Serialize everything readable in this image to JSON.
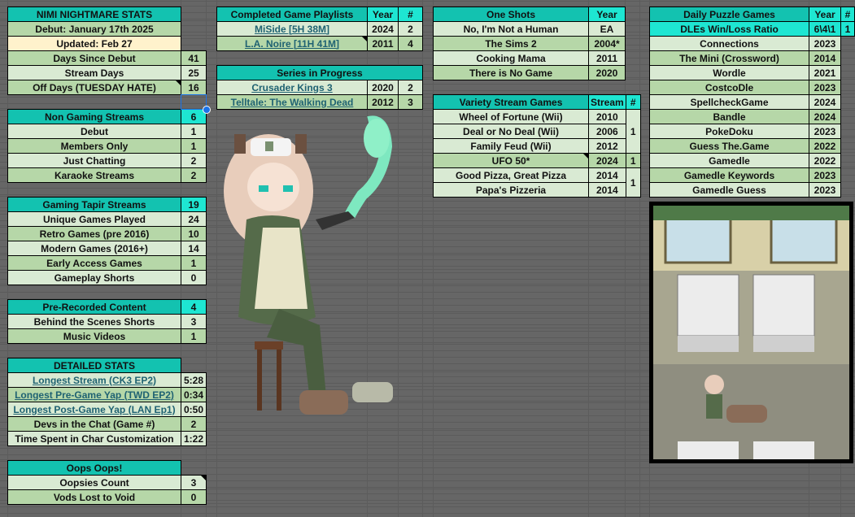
{
  "tables": {
    "nimi_stats": {
      "rows": [
        {
          "tone": "header",
          "cells": [
            "NIMI NIGHTMARE STATS"
          ]
        },
        {
          "tone": "mid",
          "cells": [
            "Debut: January 17th 2025"
          ]
        },
        {
          "tone": "cream",
          "cells": [
            "Updated: Feb 27"
          ]
        },
        {
          "tone": "mid",
          "cells": [
            "Days Since Debut",
            "41"
          ]
        },
        {
          "tone": "light",
          "cells": [
            "Stream Days",
            "25"
          ]
        },
        {
          "tone": "mid",
          "cells": [
            "Off Days (TUESDAY HATE)",
            "16"
          ],
          "note": 0
        }
      ]
    },
    "non_gaming": {
      "rows": [
        {
          "tone": "header",
          "cells": [
            "Non Gaming Streams",
            "6"
          ]
        },
        {
          "tone": "light",
          "cells": [
            "Debut",
            "1"
          ]
        },
        {
          "tone": "mid",
          "cells": [
            "Members Only",
            "1"
          ]
        },
        {
          "tone": "light",
          "cells": [
            "Just Chatting",
            "2"
          ]
        },
        {
          "tone": "mid",
          "cells": [
            "Karaoke Streams",
            "2"
          ]
        }
      ]
    },
    "gaming": {
      "rows": [
        {
          "tone": "header",
          "cells": [
            "Gaming Tapir Streams",
            "19"
          ]
        },
        {
          "tone": "light",
          "cells": [
            "Unique Games Played",
            "24"
          ]
        },
        {
          "tone": "mid",
          "cells": [
            "Retro Games (pre 2016)",
            "10"
          ]
        },
        {
          "tone": "light",
          "cells": [
            "Modern Games (2016+)",
            "14"
          ]
        },
        {
          "tone": "mid",
          "cells": [
            "Early Access Games",
            "1"
          ]
        },
        {
          "tone": "light",
          "cells": [
            "Gameplay Shorts",
            "0"
          ]
        }
      ]
    },
    "prerecorded": {
      "rows": [
        {
          "tone": "header",
          "cells": [
            "Pre-Recorded Content",
            "4"
          ]
        },
        {
          "tone": "light",
          "cells": [
            "Behind the Scenes Shorts",
            "3"
          ]
        },
        {
          "tone": "mid",
          "cells": [
            "Music Videos",
            "1"
          ]
        }
      ]
    },
    "detailed": {
      "rows": [
        {
          "tone": "header",
          "cells": [
            "DETAILED STATS"
          ]
        },
        {
          "tone": "light",
          "cells": [
            "Longest Stream (CK3 EP2)",
            "5:28"
          ],
          "link": 0
        },
        {
          "tone": "mid",
          "cells": [
            "Longest Pre-Game Yap (TWD EP2)",
            "0:34"
          ],
          "link": 0
        },
        {
          "tone": "light",
          "cells": [
            "Longest Post-Game Yap (LAN Ep1)",
            "0:50"
          ],
          "link": 0
        },
        {
          "tone": "mid",
          "cells": [
            "Devs in the Chat (Game #)",
            "2"
          ]
        },
        {
          "tone": "light",
          "cells": [
            "Time Spent in Char Customization",
            "1:22"
          ]
        }
      ]
    },
    "oops": {
      "rows": [
        {
          "tone": "header",
          "cells": [
            "Oops Oops!"
          ]
        },
        {
          "tone": "light",
          "cells": [
            "Oopsies Count",
            "3"
          ],
          "note": 1
        },
        {
          "tone": "mid",
          "cells": [
            "Vods Lost to Void",
            "0"
          ]
        }
      ]
    },
    "completed": {
      "rows": [
        {
          "tone": "header",
          "cells": [
            "Completed Game Playlists",
            "Year",
            "#"
          ]
        },
        {
          "tone": "light",
          "cells": [
            "MiSide  [5H 38M]",
            "2024",
            "2"
          ],
          "link": 0
        },
        {
          "tone": "mid",
          "cells": [
            "L.A. Noire [11H 41M]",
            "2011",
            "4"
          ],
          "link": 0,
          "note": 0
        }
      ]
    },
    "series": {
      "rows": [
        {
          "tone": "header",
          "cells": [
            "Series in Progress"
          ],
          "span": 3
        },
        {
          "tone": "light",
          "cells": [
            "Crusader Kings 3",
            "2020",
            "2"
          ],
          "link": 0
        },
        {
          "tone": "mid",
          "cells": [
            "Telltale: The Walking Dead",
            "2012",
            "3"
          ],
          "link": 0
        }
      ]
    },
    "one_shots": {
      "rows": [
        {
          "tone": "header",
          "cells": [
            "One Shots",
            "Year"
          ]
        },
        {
          "tone": "light",
          "cells": [
            "No, I'm Not a Human",
            "EA"
          ]
        },
        {
          "tone": "mid",
          "cells": [
            "The Sims 2",
            "2004*"
          ]
        },
        {
          "tone": "light",
          "cells": [
            "Cooking Mama",
            "2011"
          ]
        },
        {
          "tone": "mid",
          "cells": [
            "There is No Game",
            "2020"
          ]
        }
      ]
    },
    "variety": {
      "rows": [
        {
          "tone": "header",
          "cells": [
            "Variety Stream Games",
            "Stream",
            "#"
          ]
        },
        {
          "tone": "light",
          "cells": [
            "Wheel of Fortune (Wii)",
            "2010",
            {
              "v": "1",
              "rs": 3
            }
          ]
        },
        {
          "tone": "light",
          "cells": [
            "Deal or No Deal (Wii)",
            "2006",
            null
          ]
        },
        {
          "tone": "light",
          "cells": [
            "Family Feud (Wii)",
            "2012",
            null
          ]
        },
        {
          "tone": "mid",
          "cells": [
            "UFO 50*",
            "2024",
            "1"
          ],
          "note": 0
        },
        {
          "tone": "light",
          "cells": [
            "Good Pizza, Great Pizza",
            "2014",
            {
              "v": "1",
              "rs": 2
            }
          ]
        },
        {
          "tone": "light",
          "cells": [
            "Papa's Pizzeria",
            "2014",
            null
          ]
        }
      ]
    },
    "daily": {
      "rows": [
        {
          "tone": "header",
          "cells": [
            "Daily Puzzle Games",
            "Year",
            "#"
          ]
        },
        {
          "tone": "bright",
          "cells": [
            "DLEs Win/Loss Ratio",
            "6\\4\\1",
            "1"
          ]
        },
        {
          "tone": "light",
          "cells": [
            "Connections",
            "2023"
          ]
        },
        {
          "tone": "mid",
          "cells": [
            "The Mini (Crossword)",
            "2014"
          ]
        },
        {
          "tone": "light",
          "cells": [
            "Wordle",
            "2021"
          ]
        },
        {
          "tone": "mid",
          "cells": [
            "CostcoDle",
            "2023"
          ]
        },
        {
          "tone": "light",
          "cells": [
            "SpellcheckGame",
            "2024"
          ]
        },
        {
          "tone": "mid",
          "cells": [
            "Bandle",
            "2024"
          ]
        },
        {
          "tone": "light",
          "cells": [
            "PokeDoku",
            "2023"
          ]
        },
        {
          "tone": "mid",
          "cells": [
            "Guess The.Game",
            "2022"
          ]
        },
        {
          "tone": "light",
          "cells": [
            "Gamedle",
            "2022"
          ]
        },
        {
          "tone": "mid",
          "cells": [
            "Gamedle Keywords",
            "2023"
          ]
        },
        {
          "tone": "light",
          "cells": [
            "Gamedle Guess",
            "2023"
          ]
        }
      ]
    }
  }
}
